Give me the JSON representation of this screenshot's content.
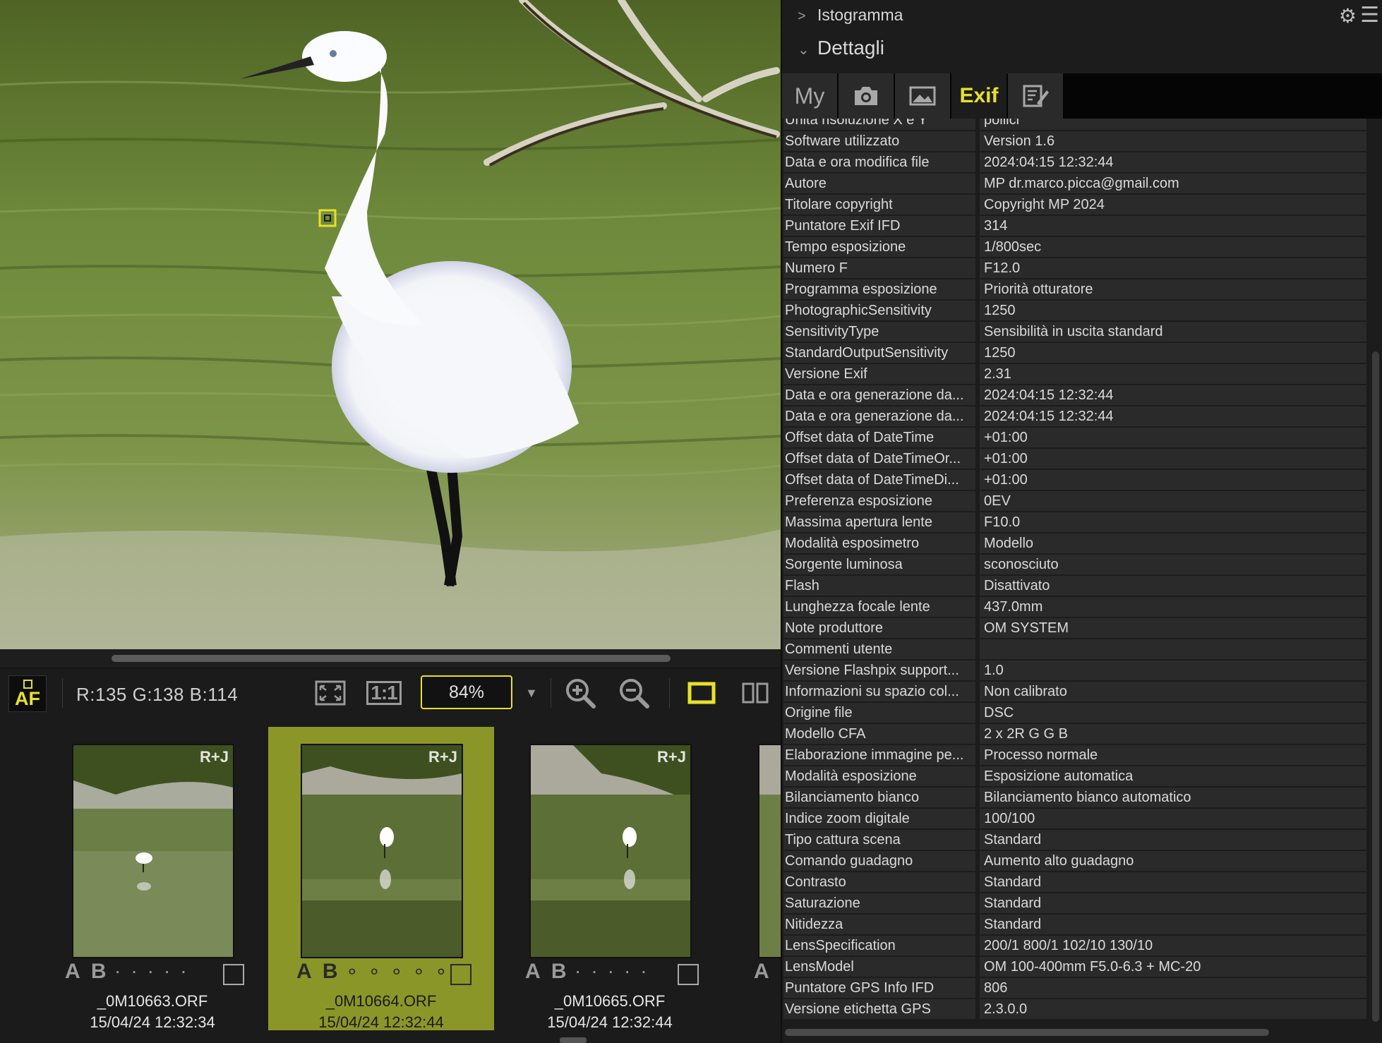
{
  "panel": {
    "sections": [
      {
        "label": "Istogramma",
        "chevron": ">"
      },
      {
        "label": "Dettagli",
        "chevron": "⌄"
      }
    ],
    "tabs": [
      {
        "label": "My",
        "icon": ""
      },
      {
        "label": "",
        "icon": "camera-icon"
      },
      {
        "label": "",
        "icon": "image-icon"
      },
      {
        "label": "Exif",
        "icon": ""
      },
      {
        "label": "",
        "icon": "edit-note-icon"
      }
    ],
    "active_tab": "Exif",
    "exif_rows": [
      {
        "key": "Unità risoluzione X e Y",
        "value": "pollici"
      },
      {
        "key": "Software utilizzato",
        "value": "Version 1.6"
      },
      {
        "key": "Data e ora modifica file",
        "value": "2024:04:15 12:32:44"
      },
      {
        "key": "Autore",
        "value": "MP dr.marco.picca@gmail.com"
      },
      {
        "key": "Titolare copyright",
        "value": "Copyright MP 2024"
      },
      {
        "key": "Puntatore Exif IFD",
        "value": "314"
      },
      {
        "key": "Tempo esposizione",
        "value": "1/800sec"
      },
      {
        "key": "Numero F",
        "value": "F12.0"
      },
      {
        "key": "Programma esposizione",
        "value": "Priorità otturatore"
      },
      {
        "key": "PhotographicSensitivity",
        "value": "1250"
      },
      {
        "key": "SensitivityType",
        "value": "Sensibilità in uscita standard"
      },
      {
        "key": "StandardOutputSensitivity",
        "value": "1250"
      },
      {
        "key": "Versione Exif",
        "value": "2.31"
      },
      {
        "key": "Data e ora generazione da...",
        "value": "2024:04:15 12:32:44"
      },
      {
        "key": "Data e ora generazione da...",
        "value": "2024:04:15 12:32:44"
      },
      {
        "key": "Offset data of DateTime",
        "value": "+01:00"
      },
      {
        "key": "Offset data of DateTimeOr...",
        "value": "+01:00"
      },
      {
        "key": "Offset data of DateTimeDi...",
        "value": "+01:00"
      },
      {
        "key": "Preferenza esposizione",
        "value": "0EV"
      },
      {
        "key": "Massima apertura lente",
        "value": "F10.0"
      },
      {
        "key": "Modalità esposimetro",
        "value": "Modello"
      },
      {
        "key": "Sorgente luminosa",
        "value": "sconosciuto"
      },
      {
        "key": "Flash",
        "value": "Disattivato"
      },
      {
        "key": "Lunghezza focale lente",
        "value": "437.0mm"
      },
      {
        "key": "Note produttore",
        "value": "OM SYSTEM"
      },
      {
        "key": "Commenti utente",
        "value": ""
      },
      {
        "key": "Versione Flashpix support...",
        "value": "1.0"
      },
      {
        "key": "Informazioni su spazio col...",
        "value": "Non calibrato"
      },
      {
        "key": "Origine file",
        "value": "DSC"
      },
      {
        "key": "Modello CFA",
        "value": "2 x 2R G G B"
      },
      {
        "key": "Elaborazione immagine pe...",
        "value": "Processo normale"
      },
      {
        "key": "Modalità esposizione",
        "value": "Esposizione automatica"
      },
      {
        "key": "Bilanciamento bianco",
        "value": "Bilanciamento bianco automatico"
      },
      {
        "key": "Indice zoom digitale",
        "value": "100/100"
      },
      {
        "key": "Tipo cattura scena",
        "value": "Standard"
      },
      {
        "key": "Comando guadagno",
        "value": "Aumento alto guadagno"
      },
      {
        "key": "Contrasto",
        "value": "Standard"
      },
      {
        "key": "Saturazione",
        "value": "Standard"
      },
      {
        "key": "Nitidezza",
        "value": "Standard"
      },
      {
        "key": "LensSpecification",
        "value": "200/1 800/1 102/10 130/10"
      },
      {
        "key": "LensModel",
        "value": "OM 100-400mm F5.0-6.3 + MC-20"
      },
      {
        "key": "Puntatore GPS Info IFD",
        "value": "806"
      },
      {
        "key": "Versione etichetta GPS",
        "value": "2.3.0.0"
      }
    ]
  },
  "toolbar": {
    "af_label": "AF",
    "rgb_readout": "R:135 G:138 B:114",
    "one_to_one_label": "1:1",
    "zoom_value": "84%",
    "zoom_dropdown": "▼"
  },
  "filmstrip": {
    "items": [
      {
        "filename": "_0M10663.ORF",
        "date": "15/04/24 12:32:34",
        "badge": "R+J",
        "ab": "A B",
        "selected": false
      },
      {
        "filename": "_0M10664.ORF",
        "date": "15/04/24 12:32:44",
        "badge": "R+J",
        "ab": "A B",
        "selected": true
      },
      {
        "filename": "_0M10665.ORF",
        "date": "15/04/24 12:32:44",
        "badge": "R+J",
        "ab": "A B",
        "selected": false
      }
    ],
    "partial_left_label": "",
    "partial_right_label": "A"
  },
  "colors": {
    "accent": "#e8e02a",
    "selected_thumb": "#8b9628"
  }
}
